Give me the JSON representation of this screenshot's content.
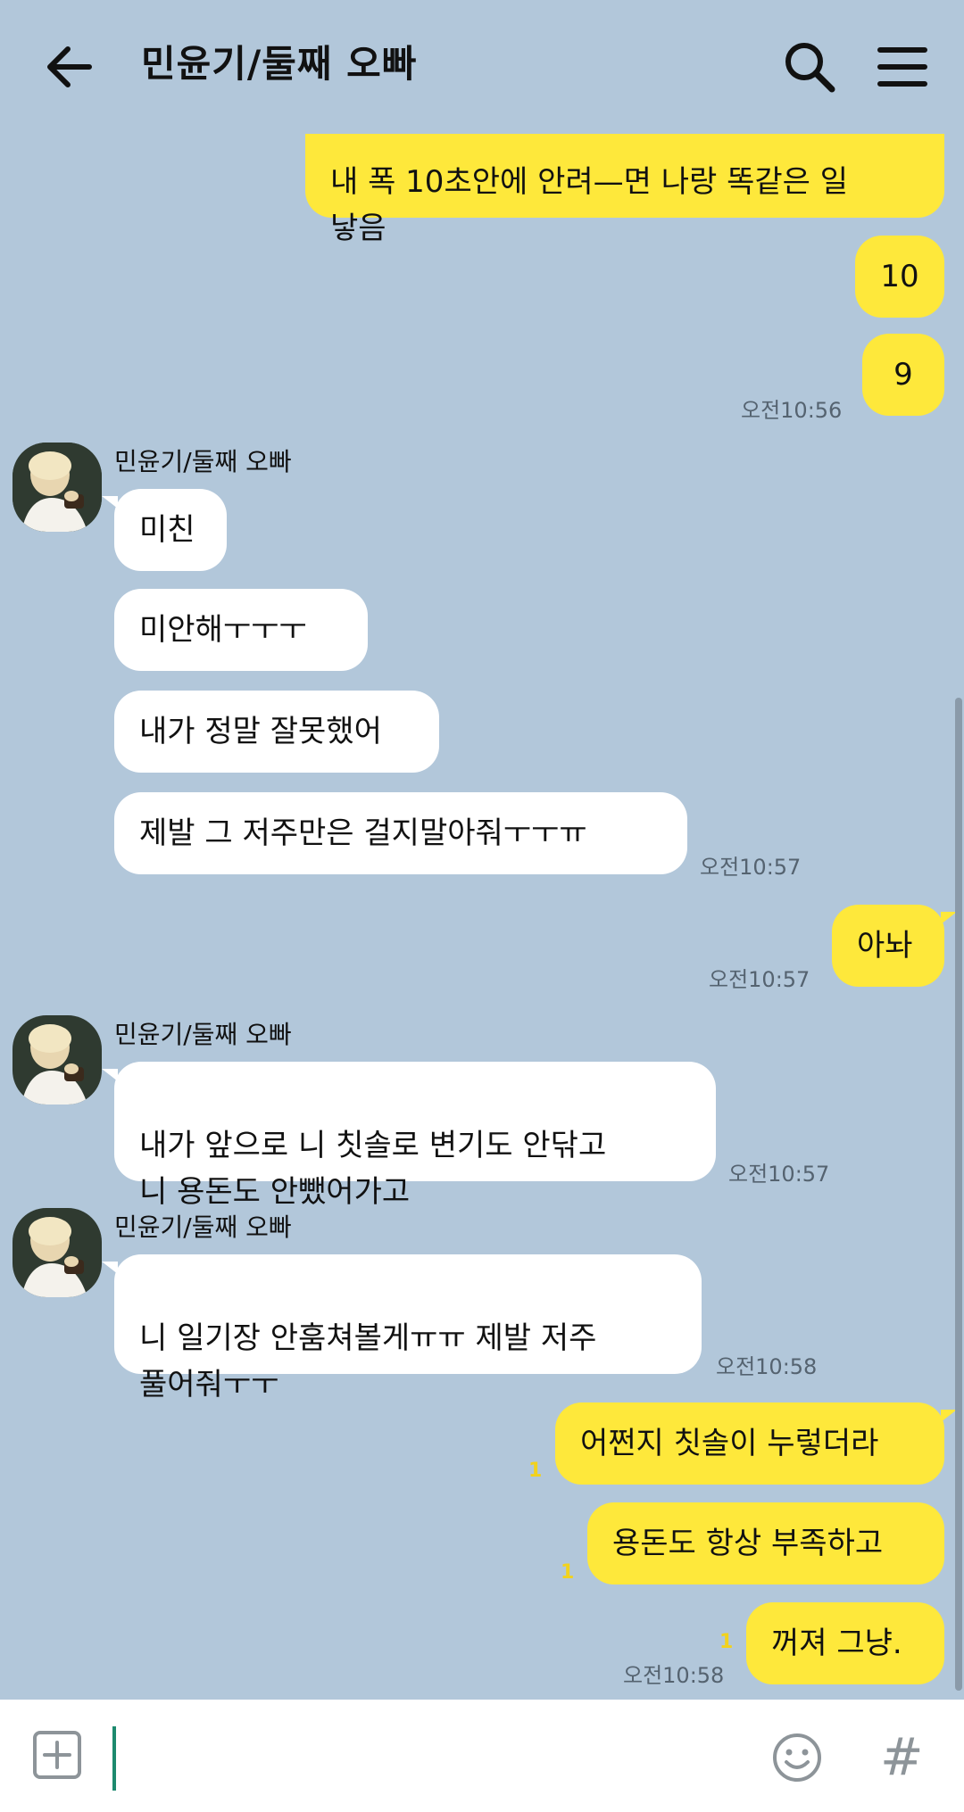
{
  "header": {
    "title": "민윤기/둘째 오빠"
  },
  "messages": {
    "m1": "내 폭 10초안에 안려—면 나랑 똑같은 일\n낳음",
    "m2": "10",
    "m3": "9",
    "t3": "오전10:56",
    "sender1": "민윤기/둘째 오빠",
    "m4": "미친",
    "m5": "미안해ㅜㅜㅜ",
    "m6": "내가 정말 잘못했어",
    "m7": "제발 그 저주만은 걸지말아줘ㅜㅜㅠ",
    "t7": "오전10:57",
    "m8": "아놔",
    "t8": "오전10:57",
    "sender2": "민윤기/둘째 오빠",
    "m9": "내가 앞으로 니 칫솔로 변기도 안닦고\n니 용돈도 안뺐어가고",
    "t9": "오전10:57",
    "sender3": "민윤기/둘째 오빠",
    "m10": "니 일기장 안훔쳐볼게ㅠㅠ 제발 저주\n풀어줘ㅜㅜ",
    "t10": "오전10:58",
    "m11": "어쩐지 칫솔이 누렇더라",
    "u11": "1",
    "m12": "용돈도 항상 부족하고",
    "u12": "1",
    "m13": "꺼져 그냥.",
    "u13": "1",
    "t13": "오전10:58"
  },
  "input": {
    "value": ""
  },
  "icons": {
    "back": "arrow-left-icon",
    "search": "search-icon",
    "menu": "hamburger-menu-icon",
    "plus": "plus-square-icon",
    "emoji": "smiley-icon",
    "hash": "hash-icon",
    "hash_glyph": "#"
  },
  "colors": {
    "background": "#b2c7da",
    "my_bubble": "#fee83b",
    "their_bubble": "#ffffff",
    "unread": "#f2d21c",
    "cursor": "#1d8a6e"
  }
}
